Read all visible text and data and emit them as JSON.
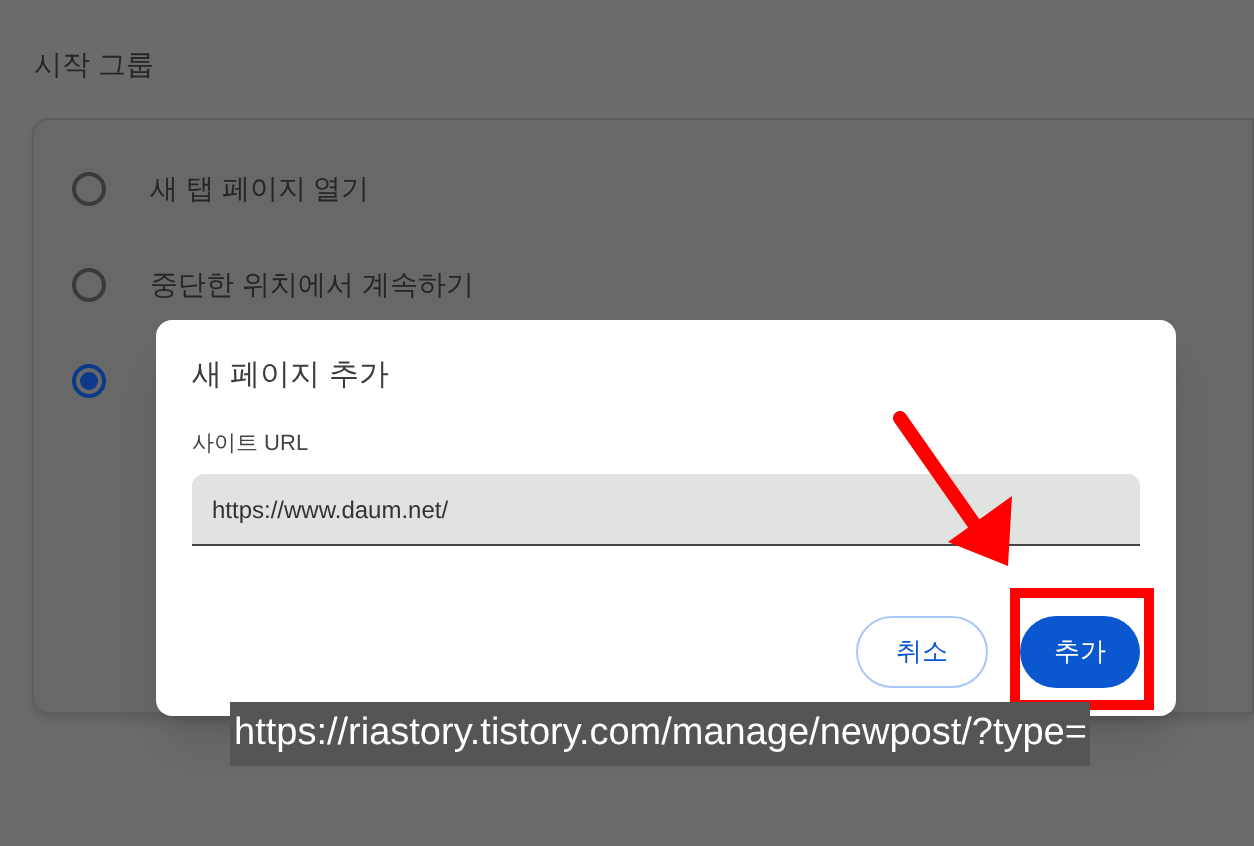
{
  "section": {
    "title": "시작 그룹",
    "options": [
      {
        "label": "새 탭 페이지 열기",
        "selected": false
      },
      {
        "label": "중단한 위치에서 계속하기",
        "selected": false
      },
      {
        "selected": true
      }
    ]
  },
  "dialog": {
    "title": "새 페이지 추가",
    "field_label": "사이트 URL",
    "value": "https://www.daum.net/",
    "buttons": [
      {
        "label": "취소",
        "kind": "secondary"
      },
      {
        "label": "추가",
        "kind": "primary"
      }
    ]
  },
  "caption": "https://riastory.tistory.com/manage/newpost/?type="
}
